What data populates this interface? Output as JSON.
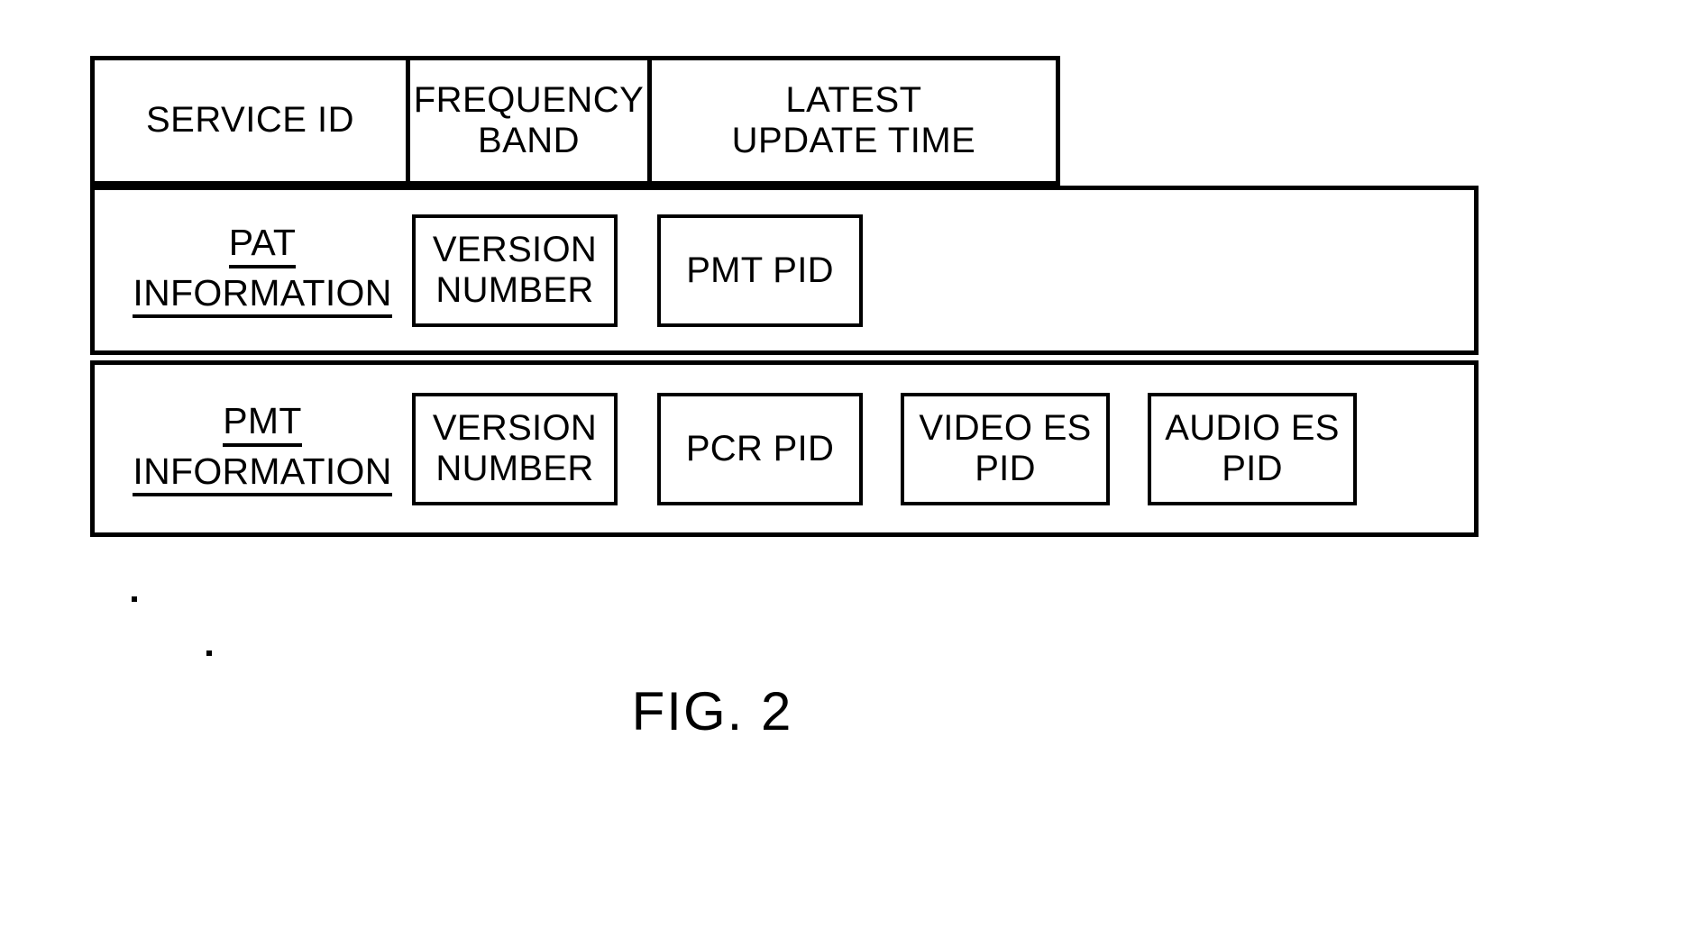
{
  "figure": {
    "caption": "FIG. 2",
    "header_row": {
      "cells": [
        {
          "label": "SERVICE ID"
        },
        {
          "label_line1": "FREQUENCY",
          "label_line2": "BAND"
        },
        {
          "label_line1": "LATEST",
          "label_line2": "UPDATE TIME"
        }
      ]
    },
    "info_rows": [
      {
        "label_line1": "PAT",
        "label_line2": "INFORMATION",
        "fields": [
          {
            "line1": "VERSION",
            "line2": "NUMBER"
          },
          {
            "line1": "PMT PID",
            "line2": ""
          }
        ]
      },
      {
        "label_line1": "PMT",
        "label_line2": "INFORMATION",
        "fields": [
          {
            "line1": "VERSION",
            "line2": "NUMBER"
          },
          {
            "line1": "PCR PID",
            "line2": ""
          },
          {
            "line1": "VIDEO ES",
            "line2": "PID"
          },
          {
            "line1": "AUDIO ES",
            "line2": "PID"
          }
        ]
      }
    ],
    "colors": {
      "stroke": "#000000",
      "background": "#ffffff"
    }
  }
}
